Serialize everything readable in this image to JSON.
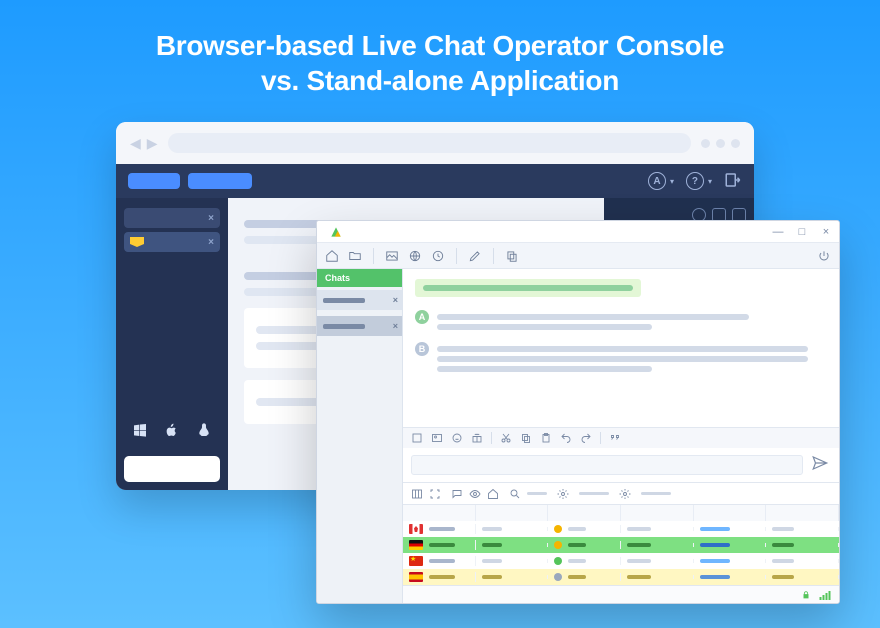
{
  "title_line1": "Browser-based Live Chat Operator Console",
  "title_line2": "vs. Stand-alone Application",
  "browser": {
    "topbar": {
      "account_icon": "A",
      "help_icon": "?",
      "logout_icon": "exit"
    },
    "left_tabs": [
      {
        "close": "×",
        "active": false
      },
      {
        "close": "×",
        "active": true
      }
    ],
    "os": {
      "win": "windows",
      "mac": "apple",
      "linux": "linux"
    }
  },
  "desktop": {
    "window_controls": {
      "min": "—",
      "max": "□",
      "close": "×"
    },
    "left_header": "Chats",
    "left_items": [
      {
        "close": "×",
        "active": false
      },
      {
        "close": "×",
        "active": true
      }
    ],
    "chat": {
      "avatar1": "A",
      "avatar2": "B"
    },
    "compose_icons": [
      "file",
      "image",
      "emoji",
      "gift",
      "cut",
      "copy",
      "paste",
      "undo",
      "redo",
      "quote"
    ],
    "grid": {
      "rows": [
        {
          "flag": "ca",
          "status": "y",
          "bg": ""
        },
        {
          "flag": "de",
          "status": "y",
          "bg": "green"
        },
        {
          "flag": "cn",
          "status": "g",
          "bg": ""
        },
        {
          "flag": "es",
          "status": "gr",
          "bg": "yellow"
        }
      ]
    },
    "status": {
      "lock": "secure",
      "signal": "online"
    }
  }
}
